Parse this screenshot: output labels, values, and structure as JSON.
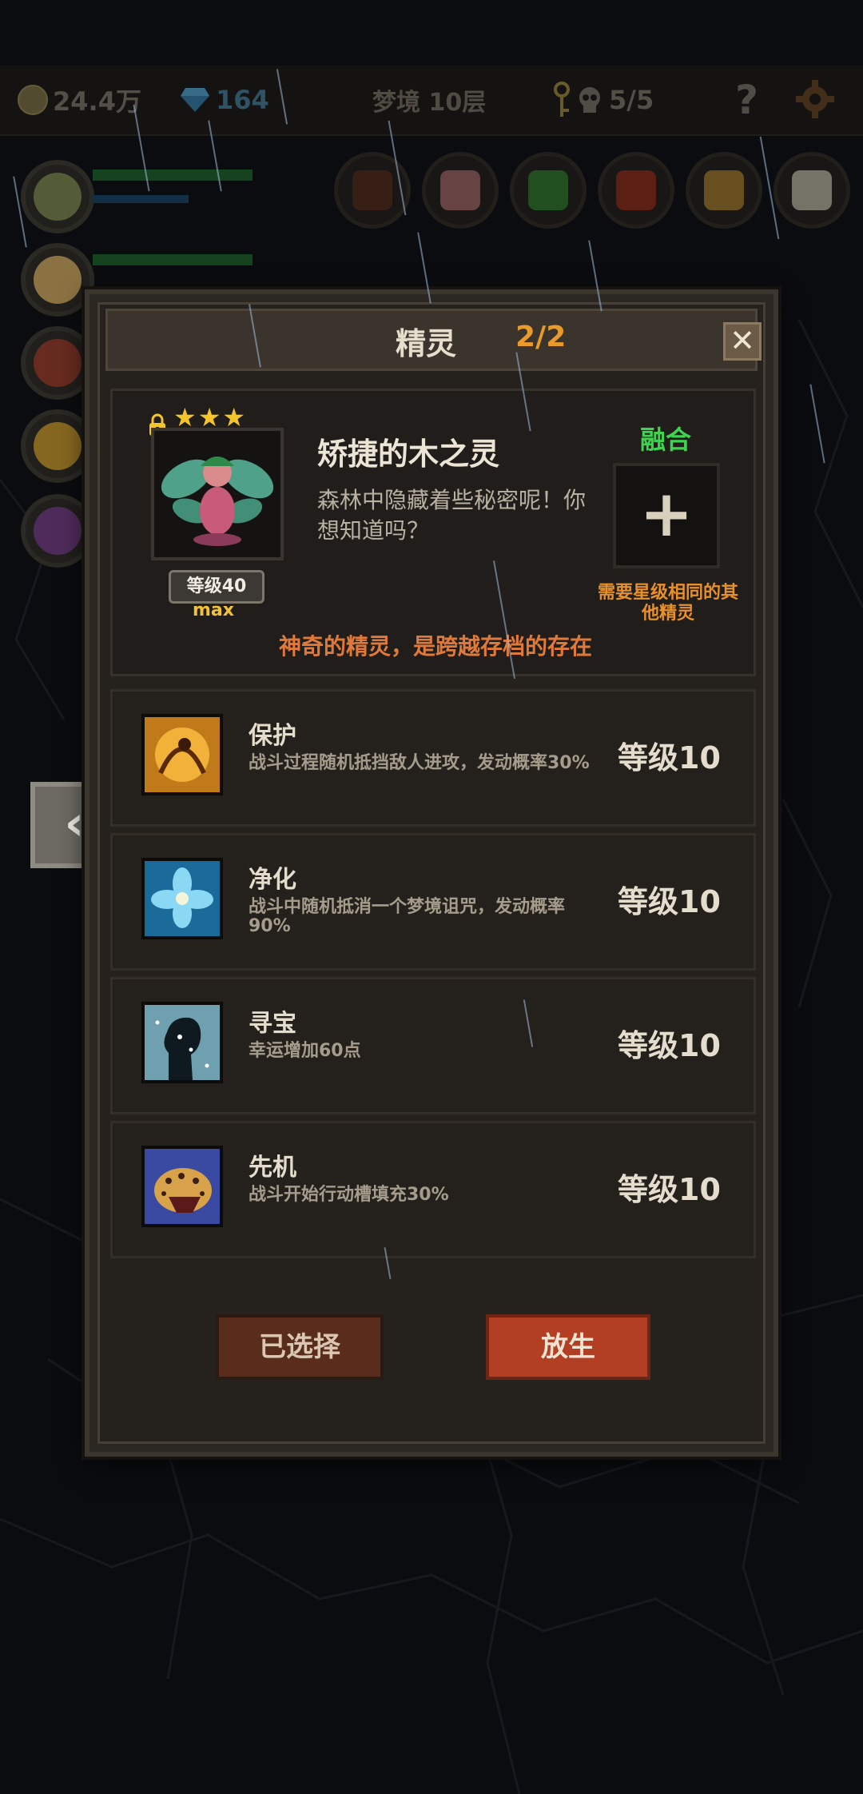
{
  "topbar": {
    "gold": "24.4万",
    "gems": "164",
    "floor": "梦境 10层",
    "skulls": "5/5",
    "help": "?"
  },
  "dialog": {
    "title": "精灵",
    "count": "2/2",
    "close": "✕",
    "spirit": {
      "stars": "★★★",
      "name": "矫捷的木之灵",
      "description": "森林中隐藏着些秘密呢！你想知道吗？",
      "level": "等级40",
      "max": "max",
      "fuse_label": "融合",
      "fuse_plus": "+",
      "fuse_note": "需要星级相同的其他精灵",
      "tagline": "神奇的精灵，是跨越存档的存在"
    },
    "skills": [
      {
        "name": "保护",
        "desc": "战斗过程随机抵挡敌人进攻，发动概率30%",
        "level": "等级10",
        "icon": "fairy-shield-icon"
      },
      {
        "name": "净化",
        "desc": "战斗中随机抵消一个梦境诅咒，发动概率90%",
        "level": "等级10",
        "icon": "blue-flower-icon"
      },
      {
        "name": "寻宝",
        "desc": "幸运增加60点",
        "level": "等级10",
        "icon": "sparkle-silhouette-icon"
      },
      {
        "name": "先机",
        "desc": "战斗开始行动槽填充30%",
        "level": "等级10",
        "icon": "leopard-icon"
      }
    ],
    "buttons": {
      "selected": "已选择",
      "release": "放生"
    }
  },
  "nav": {
    "back": "‹"
  }
}
